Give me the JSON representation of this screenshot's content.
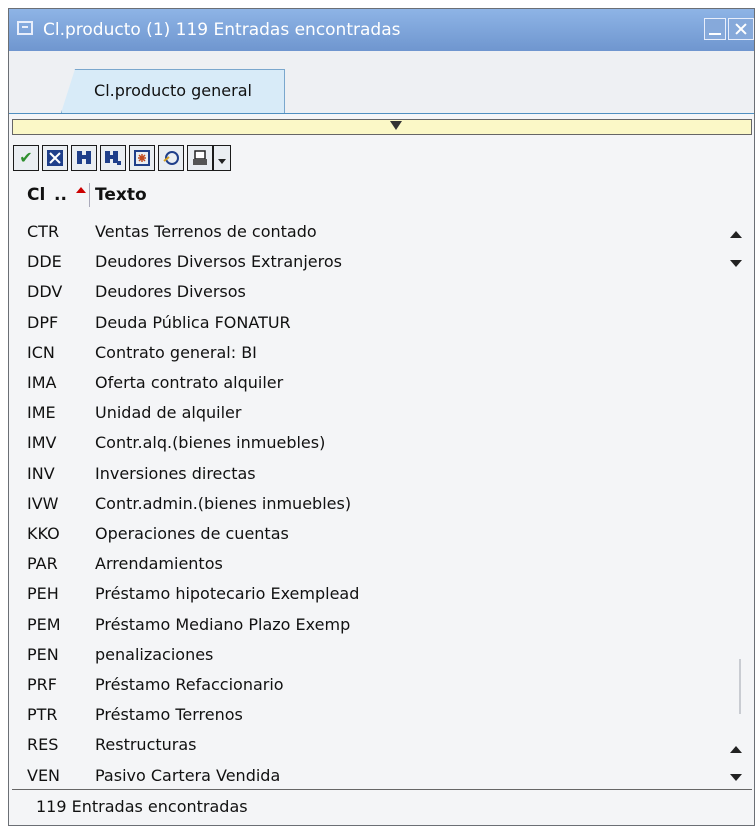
{
  "window": {
    "title": "Cl.producto (1)  119 Entradas encontradas"
  },
  "tabs": [
    {
      "label": "Cl.producto general"
    }
  ],
  "toolbar": {
    "buttons": [
      "check-icon",
      "cancel-icon",
      "find-icon",
      "find-next-icon",
      "select-all-icon",
      "information-icon",
      "print-icon",
      "dropdown-icon"
    ]
  },
  "columns": {
    "code": "Cl",
    "text": "Texto"
  },
  "rows": [
    {
      "code": "CTR",
      "text": "Ventas Terrenos de contado"
    },
    {
      "code": "DDE",
      "text": "Deudores Diversos Extranjeros"
    },
    {
      "code": "DDV",
      "text": "Deudores Diversos"
    },
    {
      "code": "DPF",
      "text": "Deuda Pública FONATUR"
    },
    {
      "code": "ICN",
      "text": "Contrato general: BI"
    },
    {
      "code": "IMA",
      "text": "Oferta contrato alquiler"
    },
    {
      "code": "IME",
      "text": "Unidad de alquiler"
    },
    {
      "code": "IMV",
      "text": "Contr.alq.(bienes inmuebles)"
    },
    {
      "code": "INV",
      "text": "Inversiones directas"
    },
    {
      "code": "IVW",
      "text": "Contr.admin.(bienes inmuebles)"
    },
    {
      "code": "KKO",
      "text": "Operaciones de cuentas"
    },
    {
      "code": "PAR",
      "text": "Arrendamientos"
    },
    {
      "code": "PEH",
      "text": "Préstamo hipotecario Exemplead"
    },
    {
      "code": "PEM",
      "text": "Préstamo Mediano Plazo Exemp"
    },
    {
      "code": "PEN",
      "text": "penalizaciones"
    },
    {
      "code": "PRF",
      "text": "Préstamo Refaccionario"
    },
    {
      "code": "PTR",
      "text": "Préstamo Terrenos"
    },
    {
      "code": "RES",
      "text": "Restructuras"
    },
    {
      "code": "VEN",
      "text": "Pasivo Cartera Vendida"
    }
  ],
  "status": {
    "text": "119 Entradas encontradas"
  }
}
